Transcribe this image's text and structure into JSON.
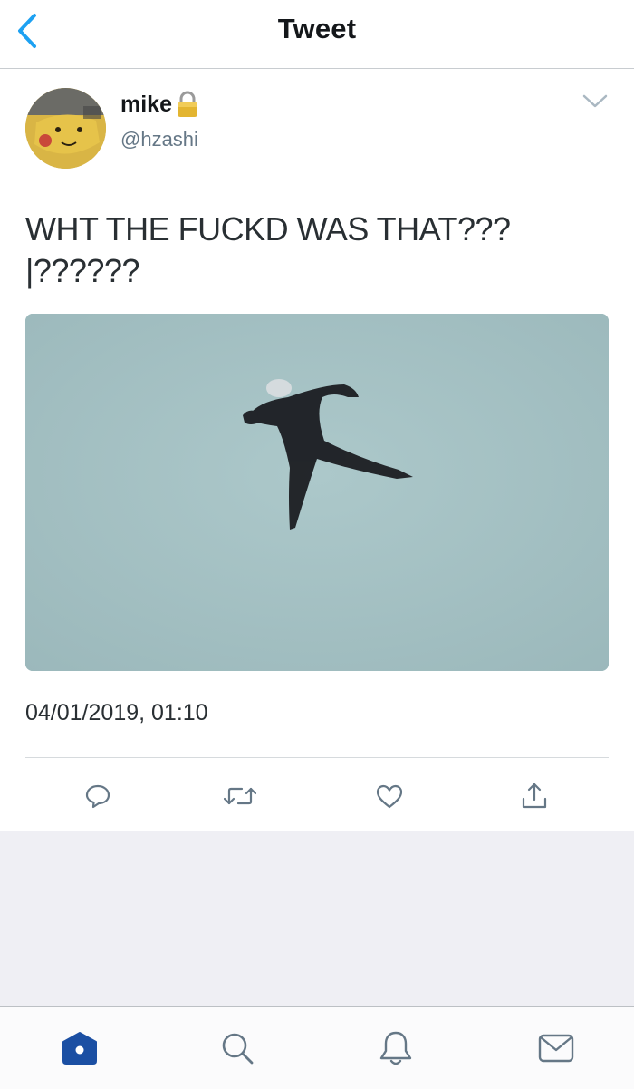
{
  "header": {
    "title": "Tweet",
    "back_icon": "chevron-left-icon"
  },
  "tweet": {
    "display_name": "mike",
    "handle": "@hzashi",
    "protected_icon": "lock-icon",
    "text": "WHT THE FUCKD WAS THAT???\n|??????",
    "timestamp": "04/01/2019, 01:10",
    "media_description_icon": "photo"
  },
  "actions": [
    {
      "icon": "reply-icon"
    },
    {
      "icon": "retweet-icon"
    },
    {
      "icon": "like-icon"
    },
    {
      "icon": "share-icon"
    }
  ],
  "tabbar": [
    {
      "icon": "home-icon",
      "active": true
    },
    {
      "icon": "search-icon",
      "active": false
    },
    {
      "icon": "notifications-icon",
      "active": false
    },
    {
      "icon": "messages-icon",
      "active": false
    }
  ],
  "colors": {
    "accent": "#1da1f2",
    "active_tab": "#1b4fa3",
    "icon_grey": "#657786",
    "handle_grey": "#657786",
    "background_grey": "#efeff4"
  }
}
